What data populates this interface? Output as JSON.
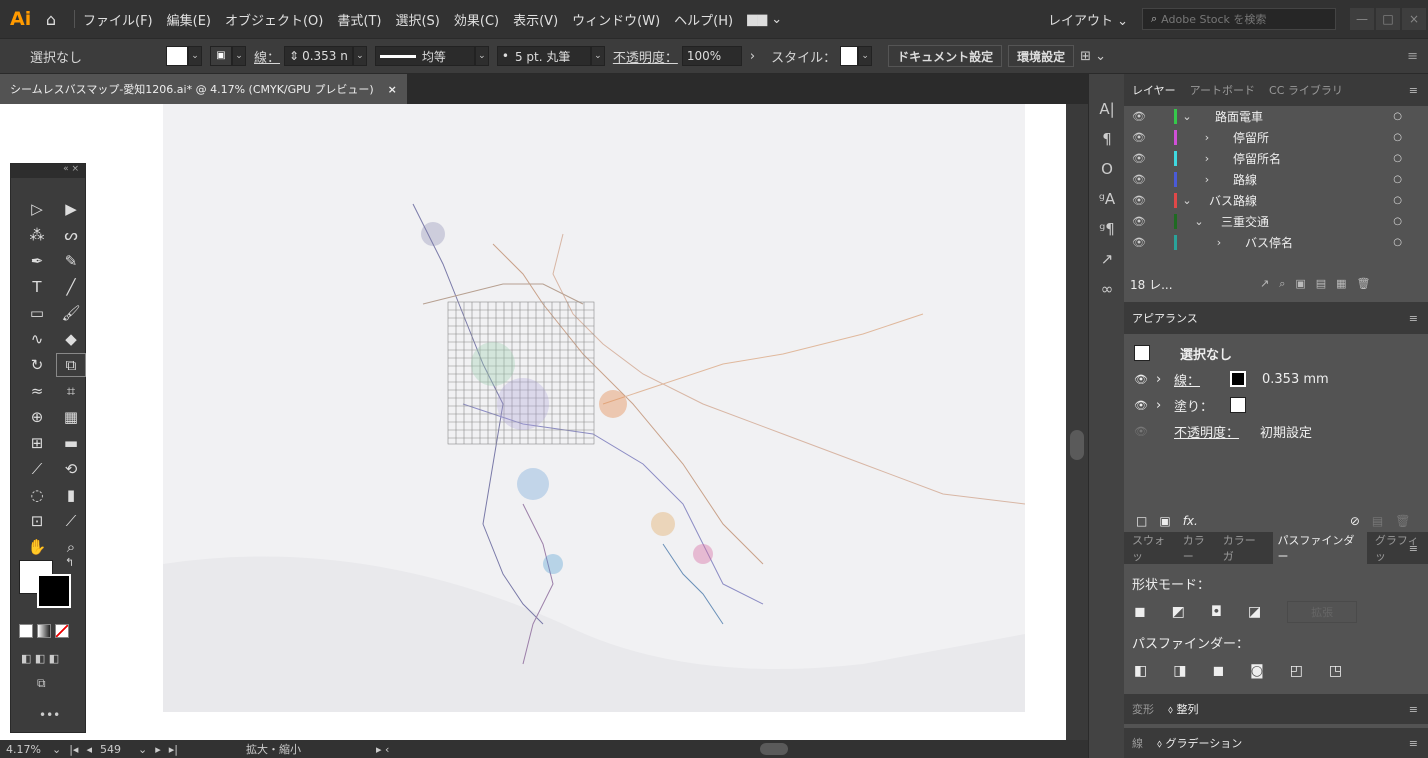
{
  "app": {
    "logo": "Ai",
    "home_icon": "home-icon"
  },
  "menu": [
    "ファイル(F)",
    "編集(E)",
    "オブジェクト(O)",
    "書式(T)",
    "選択(S)",
    "効果(C)",
    "表示(V)",
    "ウィンドウ(W)",
    "ヘルプ(H)"
  ],
  "menu_workspace_icon": "▆▆ ⌄",
  "layout_label": "レイアウト ⌄",
  "stock_search_placeholder": "Adobe Stock を検索",
  "control": {
    "selection": "選択なし",
    "stroke_label": "線：",
    "stroke_value": "0.353 n",
    "uniform_label": "均等",
    "brush_label": "5 pt. 丸筆",
    "opacity_label": "不透明度：",
    "opacity_value": "100%",
    "style_label": "スタイル：",
    "doc_settings": "ドキュメント設定",
    "preferences": "環境設定"
  },
  "document_tab": {
    "title": "シームレスバスマップ-愛知1206.ai* @ 4.17% (CMYK/GPU プレビュー)",
    "close": "×"
  },
  "status": {
    "zoom": "4.17%",
    "artboard_num": "549",
    "tool_name": "拡大・縮小"
  },
  "tools_head": "« ×",
  "layers_panel": {
    "tabs": [
      "レイヤー",
      "アートボード",
      "CC ライブラリ"
    ],
    "rows": [
      {
        "name": "路面電車",
        "color": "#35c94a",
        "indent": 0,
        "twirl": "⌄"
      },
      {
        "name": "停留所",
        "color": "#d04fd8",
        "indent": 1,
        "twirl": "›"
      },
      {
        "name": "停留所名",
        "color": "#3fd9e0",
        "indent": 1,
        "twirl": "›"
      },
      {
        "name": "路線",
        "color": "#4a5ad8",
        "indent": 1,
        "twirl": "›"
      },
      {
        "name": "バス路線",
        "color": "#e04848",
        "indent": 0,
        "twirl": "⌄"
      },
      {
        "name": "三重交通",
        "color": "#1f6b22",
        "indent": 1,
        "twirl": "⌄"
      },
      {
        "name": "バス停名",
        "color": "#2aa39a",
        "indent": 2,
        "twirl": "›"
      }
    ],
    "count": "18 レ..."
  },
  "appearance_panel": {
    "title": "アピアランス",
    "selection": "選択なし",
    "stroke_label": "線：",
    "stroke_value": "0.353 mm",
    "fill_label": "塗り：",
    "opacity_label": "不透明度：",
    "opacity_value": "初期設定",
    "fx": "fx."
  },
  "pathfinder_panel": {
    "tabs": [
      "スウォッ",
      "カラー",
      "カラーガ",
      "パスファインダー",
      "グラフィッ"
    ],
    "shape_modes": "形状モード：",
    "pathfinders": "パスファインダー：",
    "expand": "拡張"
  },
  "bottom_tabs_1": [
    "変形",
    "整列"
  ],
  "bottom_tabs_2": [
    "線",
    "グラデーション"
  ]
}
